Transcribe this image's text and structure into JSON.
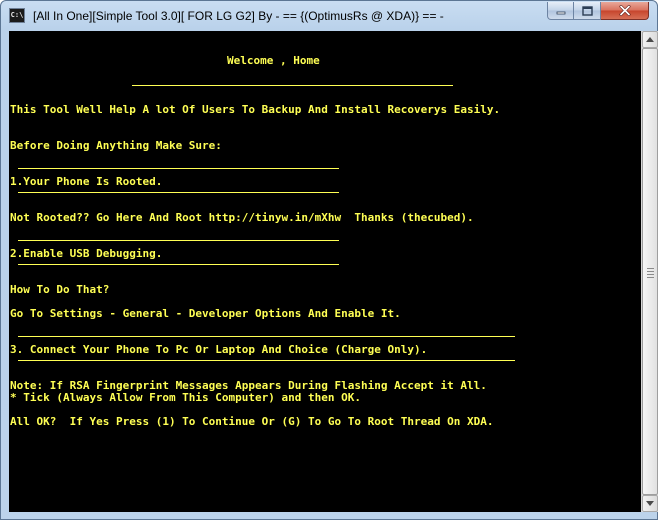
{
  "window": {
    "title": "[All In One][Simple Tool 3.0][ FOR LG G2] By - == {(OptimusRs @ XDA)} == -",
    "icon_text": "C:\\",
    "icon": "console-icon"
  },
  "controls": {
    "minimize": "minimize-icon",
    "maximize": "maximize-icon",
    "close": "close-icon"
  },
  "console": {
    "text_color": "#ffff54",
    "background": "#000000",
    "lines": {
      "welcome": "Welcome , Home",
      "intro": "This Tool Well Help A lot Of Users To Backup And Install Recoverys Easily.",
      "before": "Before Doing Anything Make Sure:",
      "step1": "1.Your Phone Is Rooted.",
      "not_rooted": "Not Rooted?? Go Here And Root http://tinyw.in/mXhw  Thanks (thecubed).",
      "step2": "2.Enable USB Debugging.",
      "how_to": "How To Do That?",
      "settings": "Go To Settings - General - Developer Options And Enable It.",
      "step3": "3. Connect Your Phone To Pc Or Laptop And Choice (Charge Only).",
      "note": "Note: If RSA Fingerprint Messages Appears During Flashing Accept it All.",
      "tick": "* Tick (Always Allow From This Computer) and then OK.",
      "prompt": "All OK?  If Yes Press (1) To Continue Or (G) To Go To Root Thread On XDA."
    }
  }
}
